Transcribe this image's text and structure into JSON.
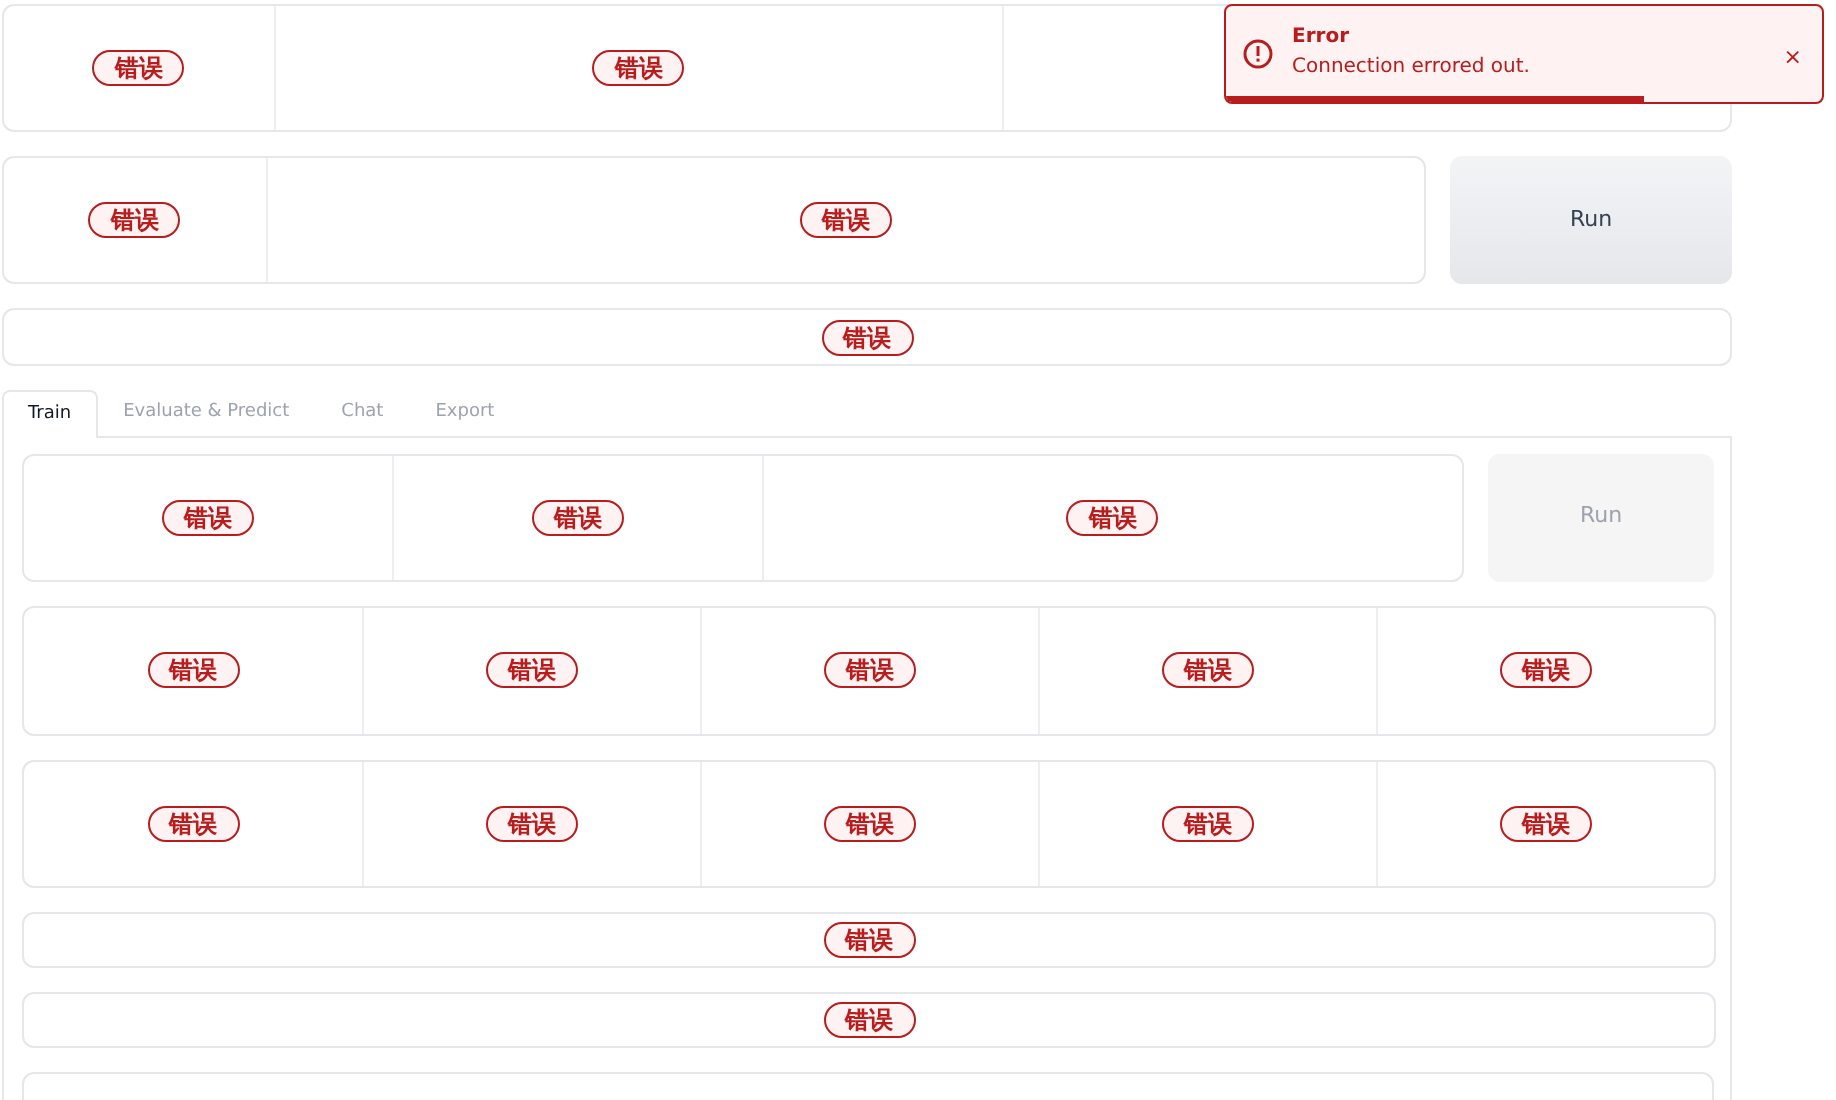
{
  "top_rows": [
    {
      "kind": "panel",
      "cells": [
        {
          "kind": "badge",
          "badge": "错误"
        },
        {
          "kind": "badge",
          "badge": "错误"
        },
        {
          "kind": "empty"
        }
      ]
    },
    {
      "kind": "panel_button",
      "cells": [
        {
          "kind": "badge",
          "badge": "错误"
        },
        {
          "kind": "badge",
          "badge": "错误"
        }
      ],
      "button": {
        "label": "Run",
        "disabled": false
      }
    },
    {
      "kind": "panel",
      "cells": [
        {
          "kind": "badge",
          "badge": "错误"
        }
      ]
    }
  ],
  "tabs": [
    {
      "label": "Train",
      "selected": true
    },
    {
      "label": "Evaluate & Predict",
      "selected": false
    },
    {
      "label": "Chat",
      "selected": false
    },
    {
      "label": "Export",
      "selected": false
    }
  ],
  "tab_rows": [
    {
      "kind": "panel_button",
      "cells": [
        {
          "kind": "badge",
          "badge": "错误"
        },
        {
          "kind": "badge",
          "badge": "错误"
        },
        {
          "kind": "badge",
          "badge": "错误"
        }
      ],
      "button": {
        "label": "Run",
        "disabled": true
      }
    },
    {
      "kind": "panel",
      "cells": [
        {
          "kind": "badge",
          "badge": "错误"
        },
        {
          "kind": "badge",
          "badge": "错误"
        },
        {
          "kind": "badge",
          "badge": "错误"
        },
        {
          "kind": "badge",
          "badge": "错误"
        },
        {
          "kind": "badge",
          "badge": "错误"
        }
      ]
    },
    {
      "kind": "panel",
      "cells": [
        {
          "kind": "badge",
          "badge": "错误"
        },
        {
          "kind": "badge",
          "badge": "错误"
        },
        {
          "kind": "badge",
          "badge": "错误"
        },
        {
          "kind": "badge",
          "badge": "错误"
        },
        {
          "kind": "badge",
          "badge": "错误"
        }
      ]
    },
    {
      "kind": "panel",
      "cells": [
        {
          "kind": "badge",
          "badge": "错误"
        }
      ]
    },
    {
      "kind": "panel",
      "cells": [
        {
          "kind": "badge",
          "badge": "错误"
        }
      ]
    },
    {
      "kind": "partial"
    }
  ],
  "toast": {
    "title": "Error",
    "message": "Connection errored out.",
    "close": "×",
    "level": 0.7
  }
}
